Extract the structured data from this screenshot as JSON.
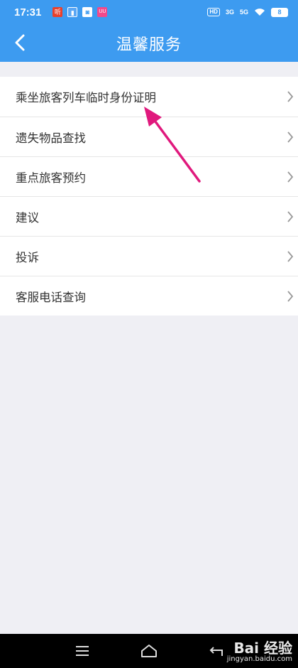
{
  "status_bar": {
    "time": "17:31",
    "notifications": [
      {
        "icon": "news-app-icon",
        "glyph": "听",
        "color": "#e8412c"
      },
      {
        "icon": "sim-card-icon",
        "glyph": "▮",
        "color": "#5aa7f5"
      },
      {
        "icon": "gallery-app-icon",
        "glyph": "◙",
        "color": "#ffffff"
      },
      {
        "icon": "shopping-app-icon",
        "glyph": "UU",
        "color": "#f24a8c"
      }
    ],
    "hd_badge": "HD",
    "sim1_network": "3G",
    "sim2_network": "5G",
    "battery": "8"
  },
  "nav_bar": {
    "title": "温馨服务",
    "background": "#3d9bf0"
  },
  "menu": {
    "items": [
      {
        "label": "乘坐旅客列车临时身份证明"
      },
      {
        "label": "遗失物品查找"
      },
      {
        "label": "重点旅客预约"
      },
      {
        "label": "建议"
      },
      {
        "label": "投诉"
      },
      {
        "label": "客服电话查询"
      }
    ]
  },
  "annotation_arrow": {
    "color": "#e0197d"
  },
  "watermark": {
    "brand": "Bai 经验",
    "url": "jingyan.baidu.com"
  }
}
